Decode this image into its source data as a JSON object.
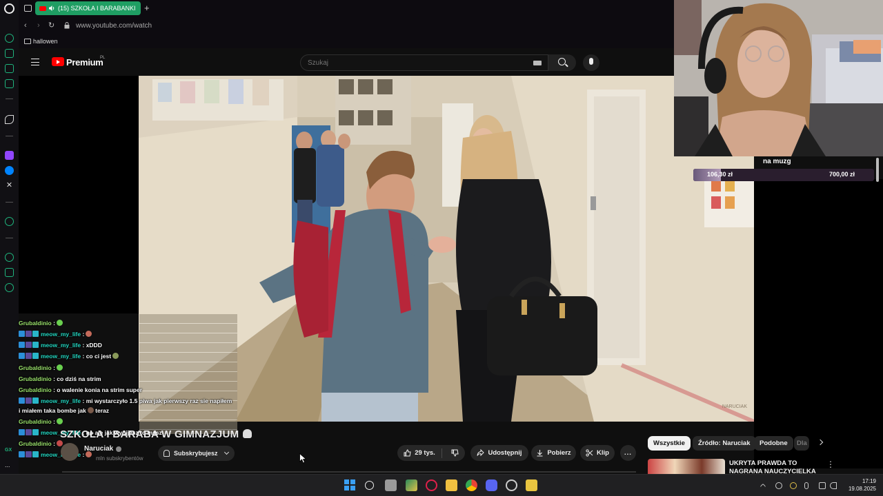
{
  "browser": {
    "active_tab_title": "(15) SZKOŁA I BARABANKI",
    "url": "www.youtube.com/watch",
    "bookmarks": [
      "hallowen"
    ]
  },
  "youtube": {
    "logo_label": "Premium",
    "region": "PL",
    "search_placeholder": "Szukaj",
    "video": {
      "title": "SZKOŁA I BARABA W GIMNAZJUM",
      "watermark": "NARUCIAK",
      "channel_name": "Naruciak",
      "subscribers": "mln subskrybentów",
      "subscribe_label": "Subskrybujesz",
      "likes": "29 tys.",
      "share_label": "Udostępnij",
      "download_label": "Pobierz",
      "clip_label": "Klip",
      "more_label": "..."
    },
    "chips": [
      "Wszystkie",
      "Źródło: Naruciak",
      "Podobne",
      "Dla"
    ],
    "recommendation": {
      "title": "UKRYTA PRAWDA TO NAGRANA NAUCZYCIELKA"
    }
  },
  "stream_overlay": {
    "goal": {
      "title": "na muzg",
      "current": "106,30 zł",
      "target": "700,00 zł",
      "progress_fraction": 0.152
    },
    "chat": [
      {
        "user": "Grubaldinio",
        "text": ":",
        "badges": 0,
        "emote": "#6ad04f",
        "user_class": "user-lime"
      },
      {
        "user": "meow_my_life",
        "text": ":",
        "badges": 3,
        "emote": "#c46a5a",
        "user_class": "user-teal"
      },
      {
        "user": "meow_my_life",
        "text": ": xDDD",
        "badges": 3,
        "emote": "",
        "user_class": "user-teal"
      },
      {
        "user": "meow_my_life",
        "text": ": co ci jest",
        "badges": 3,
        "emote": "#8a9a5a",
        "user_class": "user-teal"
      },
      {
        "user": "Grubaldinio",
        "text": ":",
        "badges": 0,
        "emote": "#6ad04f",
        "user_class": "user-lime"
      },
      {
        "user": "Grubaldinio",
        "text": ": co dziś na strim",
        "badges": 0,
        "emote": "",
        "user_class": "user-lime"
      },
      {
        "user": "Grubaldinio",
        "text": ": o walenie konia na strim super",
        "badges": 0,
        "emote": "",
        "user_class": "user-lime"
      },
      {
        "user": "meow_my_life",
        "text": ": mi wystarczyło 1.5 piwa jak pierwszy raz sie napiłem",
        "badges": 3,
        "emote": "",
        "user_class": "user-teal"
      },
      {
        "user": "",
        "text": "i miałem taka bombe jak",
        "badges": 0,
        "emote": "#7a5a4a",
        "tail": "teraz",
        "user_class": ""
      },
      {
        "user": "Grubaldinio",
        "text": ":",
        "badges": 0,
        "emote": "#6ad04f",
        "user_class": "user-lime"
      },
      {
        "user": "meow_my_life",
        "text": ": no ale jak wypijesz to masz",
        "badges": 3,
        "emote": "",
        "user_class": "user-teal"
      },
      {
        "user": "Grubaldinio",
        "text": ":",
        "badges": 0,
        "emote": "#c44a4a",
        "user_class": "user-lime"
      },
      {
        "user": "meow_my_life",
        "text": ":",
        "badges": 3,
        "emote": "#c46a5a",
        "user_class": "user-teal"
      }
    ]
  },
  "taskbar": {
    "time": "17:19",
    "date": "19.08.2025"
  },
  "colors": {
    "opera_green": "#1fb67e",
    "youtube_red": "#ff0000",
    "chat_lime": "#9be36c",
    "chat_teal": "#23d7c1"
  }
}
